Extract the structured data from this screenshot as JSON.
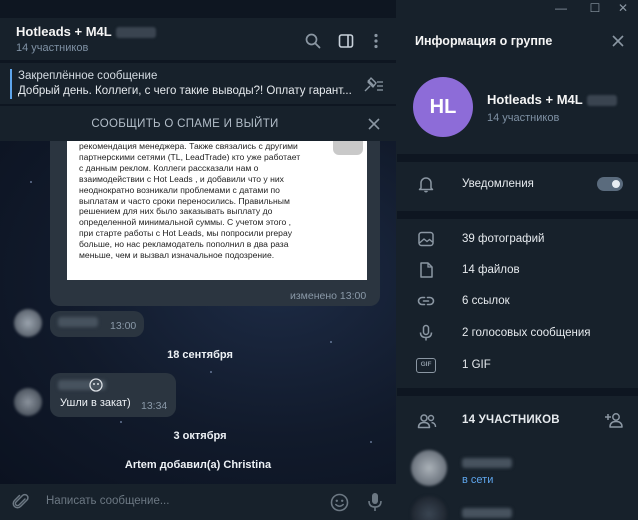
{
  "window": {
    "minimize_glyph": "—",
    "maximize_glyph": "☐",
    "close_glyph": "✕"
  },
  "chat": {
    "title": "Hotleads + M4L",
    "subtitle": "14 участников",
    "pinned": {
      "title": "Закреплённое сообщение",
      "text": "Добрый день. Коллеги, с чего такие выводы?! Оплату гарант..."
    },
    "spam_banner": "СООБЩИТЬ О СПАМЕ И ВЫЙТИ",
    "document_lines": [
      "рекомендация менеджера. Также связались с другими",
      "партнерскими сетями (TL, LeadTrade) кто уже работает",
      "с данным реклом. Коллеги рассказали нам о",
      "взаимодействии с Hot Leads , и добавили что у них",
      "неоднократно возникали проблемами с датами по",
      "выплатам и часто сроки переносились. Правильным",
      "решением для них было заказывать выплату до",
      "определенной минимальной суммы. С учетом этого ,",
      "при старте работы с Hot Leads, мы попросили prepay",
      "больше, но нас рекламодатель пополнил в два раза",
      "меньше, чем и вызвал изначальное подозрение."
    ],
    "edited_label": "изменено 13:00",
    "msg1_time": "13:00",
    "date1": "18 сентября",
    "msg2_text": "Ушли в закат)",
    "msg2_time": "13:34",
    "date2": "3 октября",
    "service_msg": "Artem добавил(а) Christina",
    "composer_placeholder": "Написать сообщение..."
  },
  "info": {
    "title": "Информация о группе",
    "avatar_initials": "HL",
    "group_name": "Hotleads + M4L",
    "members_count": "14 участников",
    "notifications_label": "Уведомления",
    "notifications_on": true,
    "media": {
      "photos": "39 фотографий",
      "files": "14 файлов",
      "links": "6 ссылок",
      "voice": "2 голосовых сообщения",
      "gif": "1 GIF",
      "gif_icon_text": "GIF"
    },
    "members_title": "14 УЧАСТНИКОВ",
    "member1_status": "в сети"
  },
  "colors": {
    "accent": "#5ea5ec",
    "avatar": "#8d6cd8",
    "panel": "#17212b",
    "chat_bg": "#0e1621",
    "bubble": "#2b3540"
  },
  "icons": [
    "search-icon",
    "sidebar-icon",
    "more-icon",
    "pin-icon",
    "close-icon",
    "attach-icon",
    "emoji-icon",
    "mic-icon",
    "bell-icon",
    "photo-icon",
    "file-icon",
    "link-icon",
    "voice-icon",
    "gif-icon",
    "members-icon",
    "add-member-icon"
  ]
}
